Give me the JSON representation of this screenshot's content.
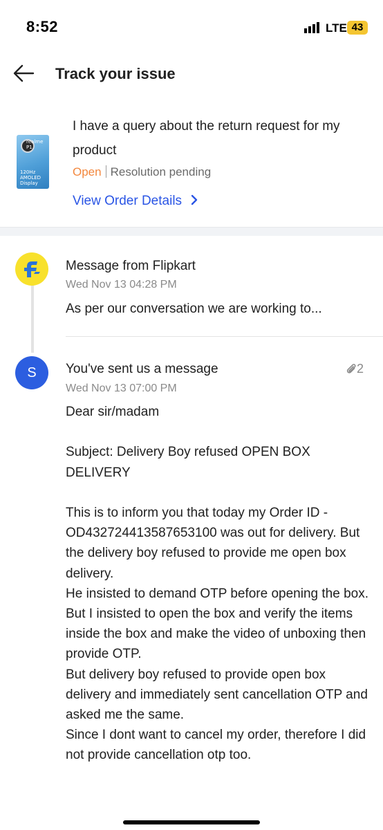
{
  "status_bar": {
    "time": "8:52",
    "network": "LTE",
    "battery": "43",
    "battery_color": "#f4c531"
  },
  "header": {
    "title": "Track your issue",
    "back_icon": "arrow-left-icon"
  },
  "issue": {
    "query": "I have a query about the return request for my product",
    "status": "Open",
    "resolution": "Resolution pending",
    "view_order_label": "View Order Details",
    "product_thumb_text": [
      "realme",
      "P1",
      "120Hz",
      "AMOLED",
      "Display"
    ]
  },
  "messages": [
    {
      "sender": "flipkart",
      "title": "Message from Flipkart",
      "time": "Wed Nov 13 04:28 PM",
      "preview": "As per our conversation we are working to..."
    },
    {
      "sender": "user",
      "avatar_letter": "S",
      "title": "You've sent us a message",
      "time": "Wed Nov 13 07:00 PM",
      "attachments": "2",
      "body": [
        "Dear sir/madam",
        "",
        "Subject: Delivery Boy refused OPEN BOX DELIVERY",
        "",
        "This is to inform you that today my Order ID - OD432724413587653100 was out for delivery. But the delivery boy refused to provide me open box delivery.",
        "He insisted to demand OTP before opening the box. But I insisted to open the box and verify the items inside the box and make the video of unboxing then provide OTP.",
        "But delivery boy refused to provide open box delivery and immediately sent cancellation OTP and asked me the same.",
        "Since I dont want to cancel my order, therefore I did not provide cancellation otp too."
      ]
    }
  ],
  "colors": {
    "accent_blue": "#2a55e5",
    "open_orange": "#f3873d",
    "flipkart_yellow": "#f8e12c",
    "avatar_blue": "#2c5ee0"
  }
}
